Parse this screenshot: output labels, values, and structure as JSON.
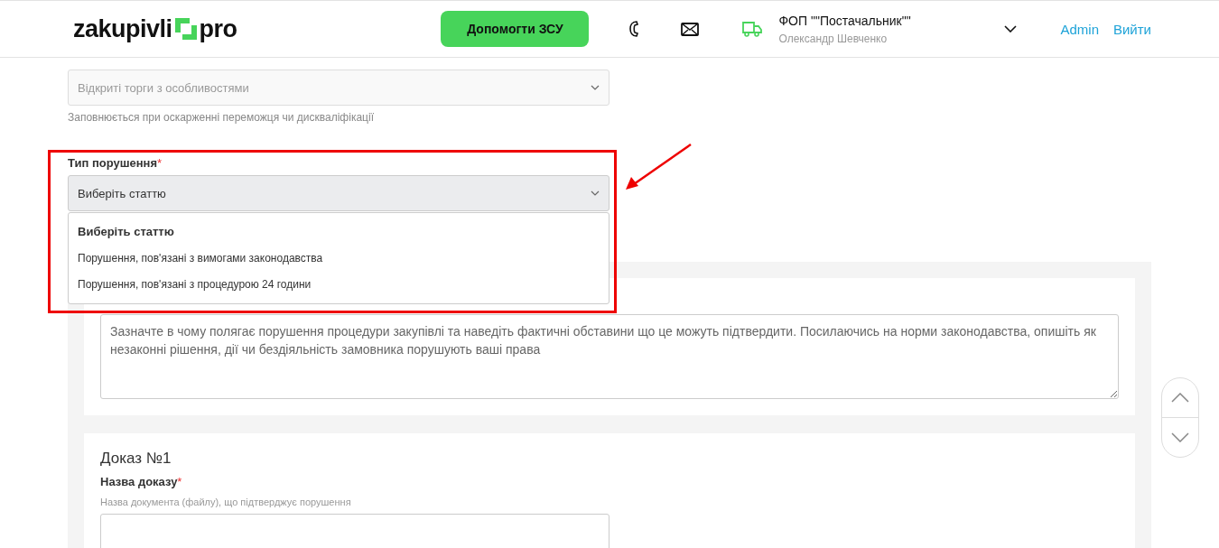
{
  "header": {
    "logo": {
      "left": "zakupivli",
      "right": "pro"
    },
    "help_button": "Допомогти ЗСУ",
    "organization": "ФОП \"\"Постачальник\"\"",
    "user": "Олександр Шевченко",
    "links": [
      "Admin",
      "Вийти"
    ]
  },
  "related_element": {
    "value": "Відкриті торги з особливостями",
    "disabled": true,
    "hint": "Заповнюється при оскарженні переможця чи дискваліфікації"
  },
  "violation_type": {
    "label": "Тип порушення",
    "required_mark": "*",
    "value": "Виберіть статтю",
    "expanded": true,
    "options": [
      {
        "label": "Виберіть статтю",
        "selected": true
      },
      {
        "label": "Порушення, пов'язані з вимогами законодавства",
        "selected": false
      },
      {
        "label": "Порушення, пов'язані з процедурою 24 години",
        "selected": false
      }
    ]
  },
  "description": {
    "placeholder": "Зазначте в чому полягає порушення процедури закупівлі та наведіть фактичні обставини що це можуть підтвердити. Посилаючись на норми законодавства, опишіть як незаконні рішення, дії чи бездіяльність замовника порушують ваші права"
  },
  "evidence": {
    "title": "Доказ №1",
    "name_label": "Назва доказу",
    "required_mark": "*",
    "hint": "Назва документа (файлу), що підтверджує порушення"
  }
}
